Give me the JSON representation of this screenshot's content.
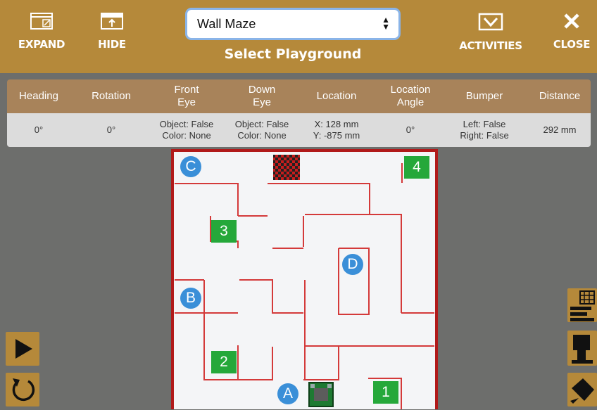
{
  "toolbar": {
    "expand_label": "EXPAND",
    "hide_label": "HIDE",
    "playground_select_value": "Wall Maze",
    "playground_select_title": "Select Playground",
    "activities_label": "ACTIVITIES",
    "close_label": "CLOSE"
  },
  "sensors": {
    "headers": [
      "Heading",
      "Rotation",
      "Front\nEye",
      "Down\nEye",
      "Location",
      "Location\nAngle",
      "Bumper",
      "Distance"
    ],
    "values": [
      "0°",
      "0°",
      "Object: False\nColor: None",
      "Object: False\nColor: None",
      "X: 128 mm\nY: -875 mm",
      "0°",
      "Left: False\nRight: False",
      "292 mm"
    ]
  },
  "maze": {
    "markers": [
      "A",
      "B",
      "C",
      "D"
    ],
    "numbers": [
      "1",
      "2",
      "3",
      "4"
    ]
  },
  "colors": {
    "toolbar": "#b5893a",
    "header_row": "#a8835a",
    "wall": "#d43a3a",
    "marker": "#3a8fd8",
    "number_box": "#25a83a",
    "background": "#6d6e6c"
  },
  "icons": {
    "expand": "expand-window-icon",
    "hide": "hide-window-icon",
    "activities": "activities-check-icon",
    "close": "close-x-icon",
    "play": "play-icon",
    "reset": "reset-icon",
    "grid": "sensor-grid-icon",
    "robot": "robot-view-icon",
    "pen": "pen-icon"
  }
}
